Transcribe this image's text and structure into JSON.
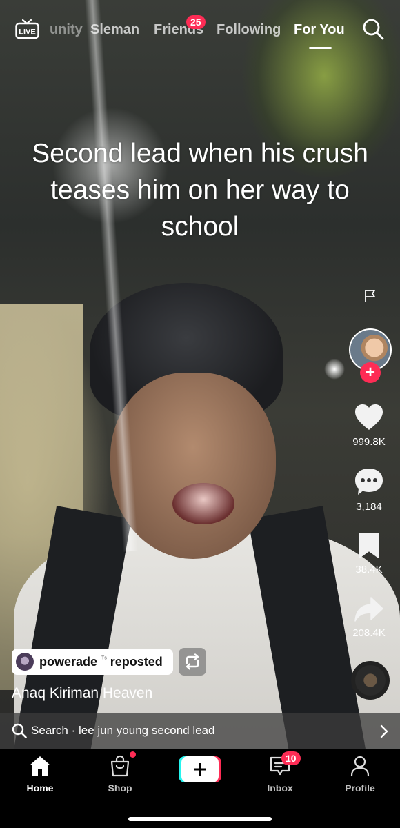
{
  "topbar": {
    "live_label": "LIVE",
    "tabs": [
      "unity",
      "Sleman",
      "Friends",
      "Following",
      "For You"
    ],
    "friends_badge": "25",
    "active_tab": "For You"
  },
  "video": {
    "caption": "Second lead when his crush teases him on her way to school"
  },
  "rail": {
    "likes": "999.8K",
    "comments": "3,184",
    "saves": "38.4K",
    "shares": "208.4K",
    "follow_symbol": "+"
  },
  "post": {
    "repost_user": "powerade",
    "repost_mark": "ᵀˢ",
    "repost_word": "reposted",
    "author": "Anaq Kiriman Heaven"
  },
  "search": {
    "text": "Search · lee jun young second lead"
  },
  "navbar": {
    "home": "Home",
    "shop": "Shop",
    "inbox": "Inbox",
    "inbox_badge": "10",
    "profile": "Profile"
  },
  "colors": {
    "accent": "#fe2c55",
    "cyan": "#25f4ee"
  },
  "icons": [
    "live-icon",
    "search-icon",
    "flag-icon",
    "heart-icon",
    "comment-icon",
    "bookmark-icon",
    "share-icon",
    "repost-icon",
    "home-icon",
    "shop-icon",
    "plus-icon",
    "inbox-icon",
    "profile-icon",
    "chevron-right-icon"
  ]
}
